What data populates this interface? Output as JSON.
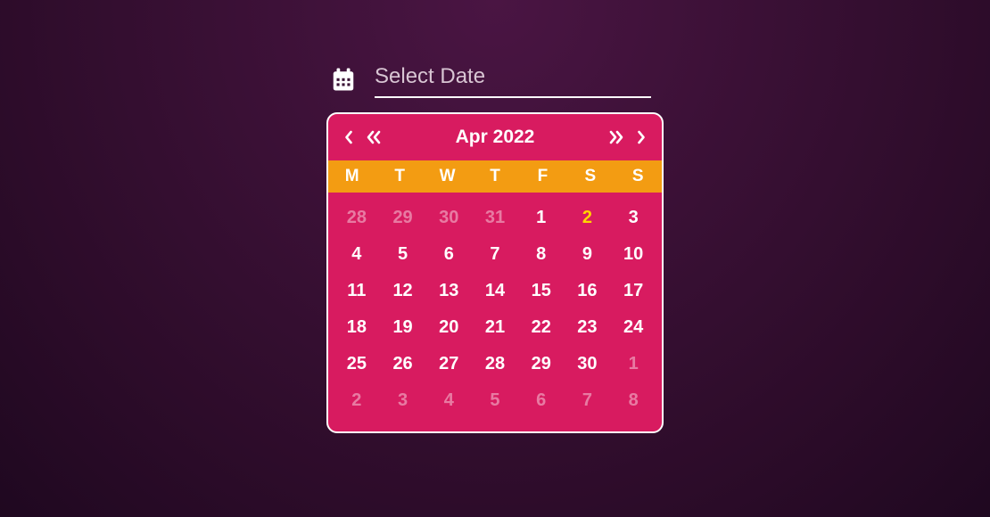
{
  "input": {
    "placeholder": "Select Date",
    "value": ""
  },
  "calendar": {
    "monthYear": "Apr 2022",
    "weekdays": [
      "M",
      "T",
      "W",
      "T",
      "F",
      "S",
      "S"
    ],
    "days": [
      {
        "n": "28",
        "other": true,
        "today": false
      },
      {
        "n": "29",
        "other": true,
        "today": false
      },
      {
        "n": "30",
        "other": true,
        "today": false
      },
      {
        "n": "31",
        "other": true,
        "today": false
      },
      {
        "n": "1",
        "other": false,
        "today": false
      },
      {
        "n": "2",
        "other": false,
        "today": true
      },
      {
        "n": "3",
        "other": false,
        "today": false
      },
      {
        "n": "4",
        "other": false,
        "today": false
      },
      {
        "n": "5",
        "other": false,
        "today": false
      },
      {
        "n": "6",
        "other": false,
        "today": false
      },
      {
        "n": "7",
        "other": false,
        "today": false
      },
      {
        "n": "8",
        "other": false,
        "today": false
      },
      {
        "n": "9",
        "other": false,
        "today": false
      },
      {
        "n": "10",
        "other": false,
        "today": false
      },
      {
        "n": "11",
        "other": false,
        "today": false
      },
      {
        "n": "12",
        "other": false,
        "today": false
      },
      {
        "n": "13",
        "other": false,
        "today": false
      },
      {
        "n": "14",
        "other": false,
        "today": false
      },
      {
        "n": "15",
        "other": false,
        "today": false
      },
      {
        "n": "16",
        "other": false,
        "today": false
      },
      {
        "n": "17",
        "other": false,
        "today": false
      },
      {
        "n": "18",
        "other": false,
        "today": false
      },
      {
        "n": "19",
        "other": false,
        "today": false
      },
      {
        "n": "20",
        "other": false,
        "today": false
      },
      {
        "n": "21",
        "other": false,
        "today": false
      },
      {
        "n": "22",
        "other": false,
        "today": false
      },
      {
        "n": "23",
        "other": false,
        "today": false
      },
      {
        "n": "24",
        "other": false,
        "today": false
      },
      {
        "n": "25",
        "other": false,
        "today": false
      },
      {
        "n": "26",
        "other": false,
        "today": false
      },
      {
        "n": "27",
        "other": false,
        "today": false
      },
      {
        "n": "28",
        "other": false,
        "today": false
      },
      {
        "n": "29",
        "other": false,
        "today": false
      },
      {
        "n": "30",
        "other": false,
        "today": false
      },
      {
        "n": "1",
        "other": true,
        "today": false
      },
      {
        "n": "2",
        "other": true,
        "today": false
      },
      {
        "n": "3",
        "other": true,
        "today": false
      },
      {
        "n": "4",
        "other": true,
        "today": false
      },
      {
        "n": "5",
        "other": true,
        "today": false
      },
      {
        "n": "6",
        "other": true,
        "today": false
      },
      {
        "n": "7",
        "other": true,
        "today": false
      },
      {
        "n": "8",
        "other": true,
        "today": false
      }
    ]
  }
}
